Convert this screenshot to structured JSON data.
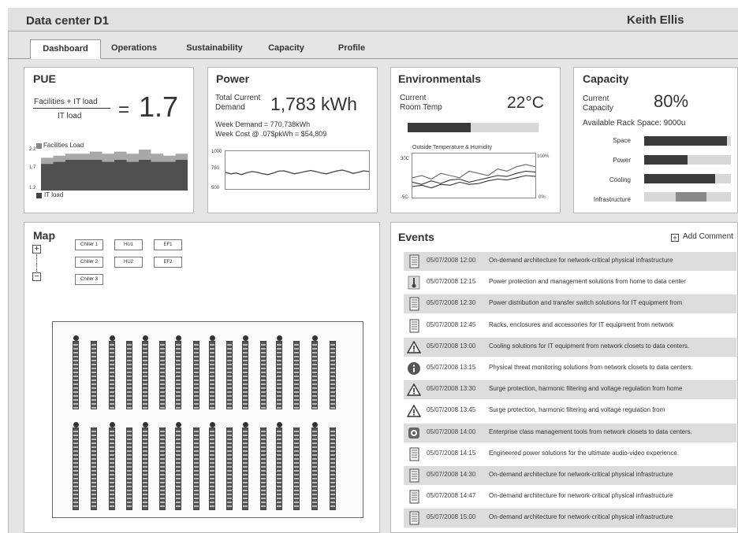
{
  "header": {
    "title": "Data center D1",
    "user": "Keith Ellis"
  },
  "tabs": [
    {
      "label": "Dashboard"
    },
    {
      "label": "Operations"
    },
    {
      "label": "Sustainability"
    },
    {
      "label": "Capacity"
    },
    {
      "label": "Profile"
    }
  ],
  "pue": {
    "title": "PUE",
    "numerator": "Facilities + IT load",
    "denominator": "IT load",
    "equals": "=",
    "value": "1.7",
    "legend_facilities": "Facilities Load",
    "legend_it": "IT load",
    "y_ticks": [
      "2.2",
      "1.7",
      "1.2"
    ],
    "chart_data": {
      "type": "area",
      "series": [
        {
          "name": "Facilities Load",
          "values": [
            2.0,
            2.0,
            2.05,
            2.05,
            2.1,
            2.1,
            2.1,
            2.1,
            2.15,
            2.15,
            2.1,
            2.1,
            2.15,
            2.15,
            2.1,
            2.1,
            2.2,
            2.2,
            2.1,
            2.1,
            2.05,
            2.05,
            2.1,
            2.1
          ]
        },
        {
          "name": "IT load",
          "values": [
            1.85,
            1.85,
            1.9,
            1.9,
            1.95,
            1.95,
            1.95,
            1.95,
            1.95,
            1.95,
            1.9,
            1.9,
            1.95,
            1.95,
            1.9,
            1.9,
            1.95,
            1.95,
            1.9,
            1.9,
            1.9,
            1.9,
            1.95,
            1.95
          ]
        }
      ],
      "ylim": [
        1.2,
        2.2
      ]
    }
  },
  "power": {
    "title": "Power",
    "label1": "Total Current",
    "label2": "Demand",
    "value": "1,783 kWh",
    "week_demand": "Week Demand = 770,738kWh",
    "week_cost": "Week Cost @ .07$pkWh = $54,809",
    "y_ticks": [
      "1000",
      "750",
      "500"
    ],
    "chart_data": {
      "type": "line",
      "values": [
        720,
        700,
        710,
        690,
        715,
        730,
        720,
        700,
        690,
        710,
        735,
        740,
        720,
        700,
        715,
        730,
        745,
        730,
        710,
        700,
        720,
        740,
        750,
        730,
        705,
        720,
        740,
        730
      ],
      "ylim": [
        500,
        1000
      ]
    }
  },
  "environmentals": {
    "title": "Environmentals",
    "label1": "Current",
    "label2": "Room Temp",
    "value": "22",
    "unit": "°C",
    "temp_fraction": 0.48,
    "chart_title": "Outside Temperature & Humidity",
    "y_left_top": "30C",
    "y_left_bottom": "-5C",
    "y_right_top": "100%",
    "y_right_bottom": "0%",
    "chart_data": {
      "type": "line",
      "series": [
        {
          "values": [
            0.45,
            0.5,
            0.42,
            0.55,
            0.5,
            0.45,
            0.6,
            0.55,
            0.5,
            0.65,
            0.6,
            0.7,
            0.75,
            0.7
          ]
        },
        {
          "values": [
            0.35,
            0.3,
            0.38,
            0.32,
            0.4,
            0.42,
            0.35,
            0.4,
            0.45,
            0.5,
            0.48,
            0.55,
            0.6,
            0.58
          ]
        },
        {
          "values": [
            0.25,
            0.28,
            0.22,
            0.3,
            0.28,
            0.35,
            0.3,
            0.32,
            0.38,
            0.42,
            0.4,
            0.45,
            0.5,
            0.48
          ]
        }
      ],
      "ylim": [
        0,
        1
      ]
    }
  },
  "capacity": {
    "title": "Capacity",
    "label1": "Current",
    "label2": "Capacity",
    "value": "80%",
    "rack_space": "Available Rack Space: 9000u",
    "rows": [
      {
        "label": "Space",
        "fraction": 0.95
      },
      {
        "label": "Power",
        "fraction": 0.5
      },
      {
        "label": "Cooling",
        "fraction": 0.82
      },
      {
        "label": "Infrastructure",
        "fraction": 0.35
      }
    ]
  },
  "map": {
    "title": "Map",
    "zoom_in": "+",
    "zoom_out": "−",
    "buttons": [
      [
        "Chiller 1",
        "HU1",
        "EF1"
      ],
      [
        "Chiller 2",
        "HU2",
        "EF2"
      ],
      [
        "Chiller 3"
      ]
    ]
  },
  "events": {
    "title": "Events",
    "add_label": "Add Comment",
    "items": [
      {
        "icon": "document-icon",
        "date": "05/07/2008 12:00",
        "text": "On-demand architecture for network-critical physical infrastructure"
      },
      {
        "icon": "thermometer-icon",
        "date": "05/07/2008 12:15",
        "text": "Power protection and management solutions from home to data center"
      },
      {
        "icon": "document-icon",
        "date": "05/07/2008 12:30",
        "text": "Power distribution and transfer switch solutions for IT equipment from"
      },
      {
        "icon": "document-icon",
        "date": "05/07/2008 12:45",
        "text": "Racks, enclosures and accessories for IT equipment from network"
      },
      {
        "icon": "warning-icon",
        "date": "05/07/2008 13:00",
        "text": "Cooling solutions for IT equipment from network closets to data centers."
      },
      {
        "icon": "info-icon",
        "date": "05/07/2008 13:15",
        "text": "Physical threat monitoring solutions from network closets to data centers."
      },
      {
        "icon": "warning-icon",
        "date": "05/07/2008 13:30",
        "text": "Surge protection, harmonic filtering and voltage regulation from home"
      },
      {
        "icon": "warning-icon",
        "date": "05/07/2008 13:45",
        "text": "Surge protection, harmonic filtering and voltage regulation from"
      },
      {
        "icon": "camera-icon",
        "date": "05/07/2008 14:00",
        "text": "Enterprise class management tools from network closets to data centers."
      },
      {
        "icon": "document-icon",
        "date": "05/07/2008 14:15",
        "text": "Engineered power solutions for the ultimate audio-video experience."
      },
      {
        "icon": "document-icon",
        "date": "05/07/2008 14:30",
        "text": "On-demand architecture for network-critical physical infrastructure"
      },
      {
        "icon": "document-icon",
        "date": "05/07/2008 14:47",
        "text": "On-demand architecture for network-critical physical infrastructure"
      },
      {
        "icon": "document-icon",
        "date": "05/07/2008 15:00",
        "text": "On-demand architecture for network-critical physical infrastructure"
      }
    ]
  }
}
